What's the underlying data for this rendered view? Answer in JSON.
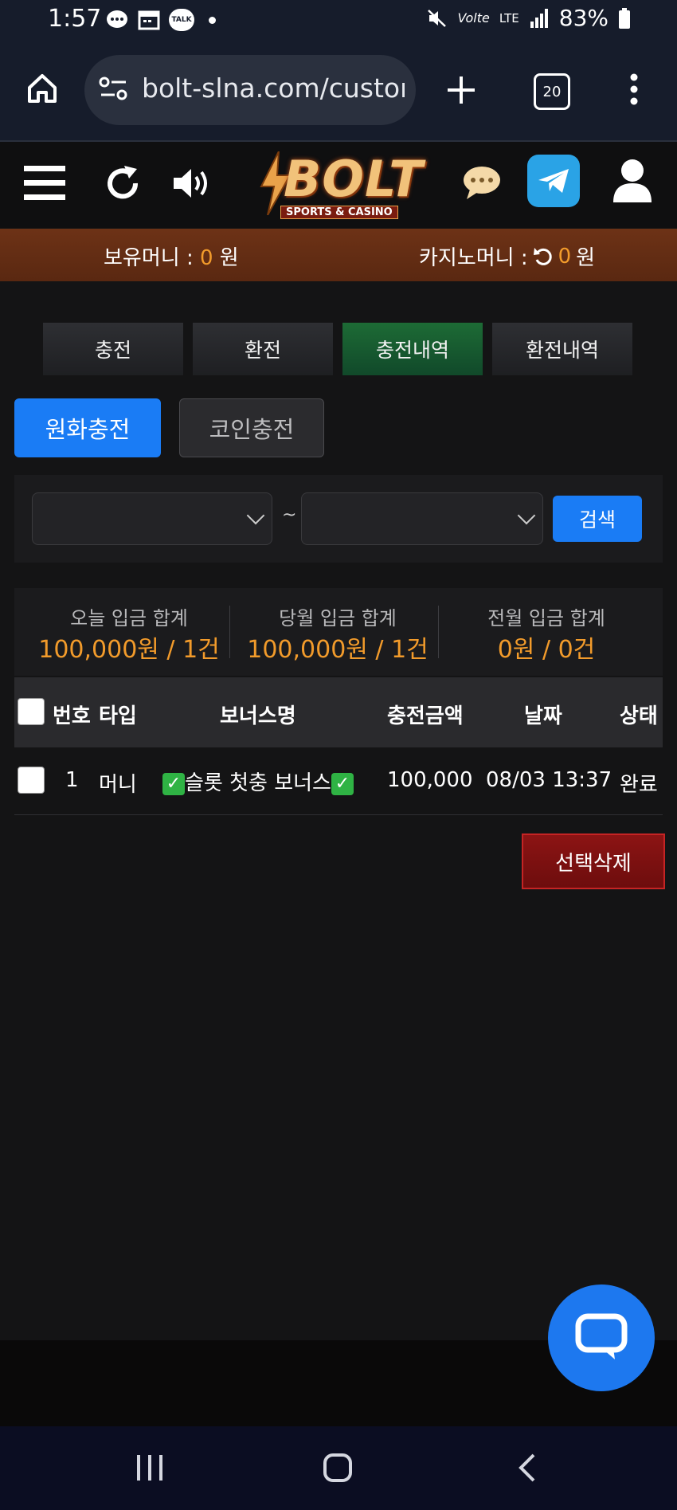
{
  "status_bar": {
    "time": "1:57",
    "notification_icons": [
      "chat-bubble-icon",
      "calendar-icon",
      "kakaotalk-icon"
    ],
    "talk_label": "TALK",
    "mute_icon": "mute-icon",
    "volte_label": "Volte",
    "lte_label": "LTE",
    "battery": "83%"
  },
  "browser": {
    "url": "bolt-slna.com/custor",
    "tab_count": "20"
  },
  "site_header": {
    "brand": "BOLT",
    "brand_sub": "SPORTS & CASINO",
    "brand_color": "#e9a24a"
  },
  "money_bar": {
    "held_label": "보유머니 :",
    "held_value": "0",
    "held_unit": "원",
    "casino_label": "카지노머니 :",
    "casino_value": "0",
    "casino_unit": "원"
  },
  "main_tabs": [
    {
      "label": "충전",
      "active": false
    },
    {
      "label": "환전",
      "active": false
    },
    {
      "label": "충전내역",
      "active": true
    },
    {
      "label": "환전내역",
      "active": false
    }
  ],
  "sub_tabs": [
    {
      "label": "원화충전",
      "active": true
    },
    {
      "label": "코인충전",
      "active": false
    }
  ],
  "search": {
    "separator": "~",
    "button_label": "검색"
  },
  "summary": [
    {
      "label": "오늘 입금 합계",
      "value": "100,000원 / 1건"
    },
    {
      "label": "당월 입금 합계",
      "value": "100,000원 / 1건"
    },
    {
      "label": "전월 입금 합계",
      "value": "0원 / 0건"
    }
  ],
  "table": {
    "headers": [
      "번호",
      "타입",
      "보너스명",
      "충전금액",
      "날짜",
      "상태"
    ],
    "rows": [
      {
        "no": "1",
        "type": "머니",
        "bonus": "슬롯 첫충 보너스",
        "amount": "100,000",
        "date": "08/03 13:37",
        "status": "완료"
      }
    ]
  },
  "delete_button": "선택삭제",
  "colors": {
    "accent_blue": "#1a7cf5",
    "active_green": "#1d6b35",
    "orange": "#f29b2b",
    "danger_red": "#8c1414"
  }
}
